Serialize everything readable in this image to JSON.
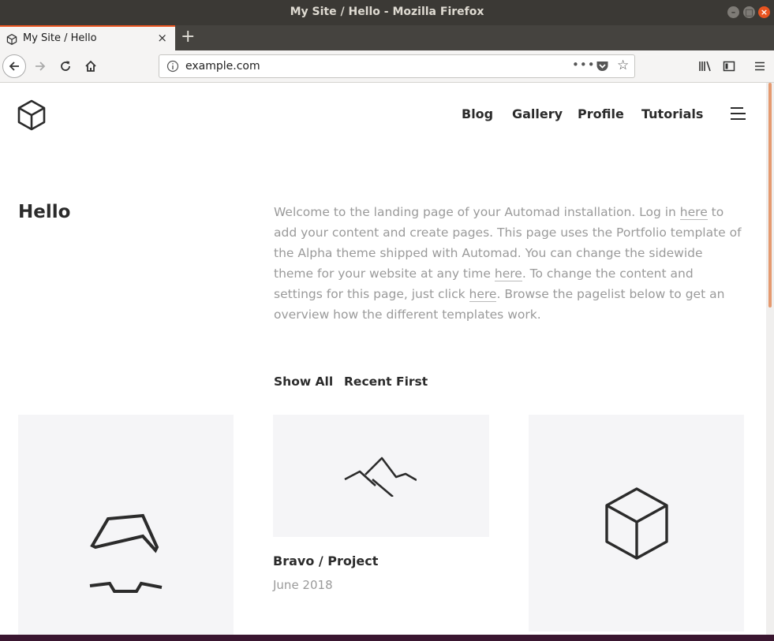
{
  "window": {
    "title": "My Site / Hello - Mozilla Firefox"
  },
  "tab": {
    "label": "My Site / Hello",
    "close": "×",
    "new_tab": "+"
  },
  "address_bar": {
    "url": "example.com",
    "page_actions": "•••",
    "bookmark": "☆"
  },
  "site": {
    "nav": [
      "Blog",
      "Gallery",
      "Profile",
      "Tutorials"
    ],
    "heading": "Hello",
    "intro": {
      "t1": "Welcome to the landing page of your Automad installation. Log in ",
      "l1": "here",
      "t2": " to add your content and create pages. This page uses the Portfolio template of the Alpha theme shipped with Automad. You can change the sidewide theme for your website at any time ",
      "l2": "here",
      "t3": ". To change the content and settings for this page, just click ",
      "l3": "here",
      "t4": ". Browse the pagelist below to get an overview how the different templates work."
    },
    "filters": {
      "show_all": "Show All",
      "recent_first": "Recent First"
    },
    "cards": [
      {
        "icon": "face-icon"
      },
      {
        "icon": "mountain-icon",
        "title": "Bravo / Project",
        "date": "June 2018"
      },
      {
        "icon": "cube-icon"
      }
    ]
  },
  "colors": {
    "accent": "#e95420",
    "titlebar": "#3b3935",
    "text": "#2b2b2b",
    "muted": "#9a9a9a",
    "card_bg": "#f5f5f7"
  }
}
